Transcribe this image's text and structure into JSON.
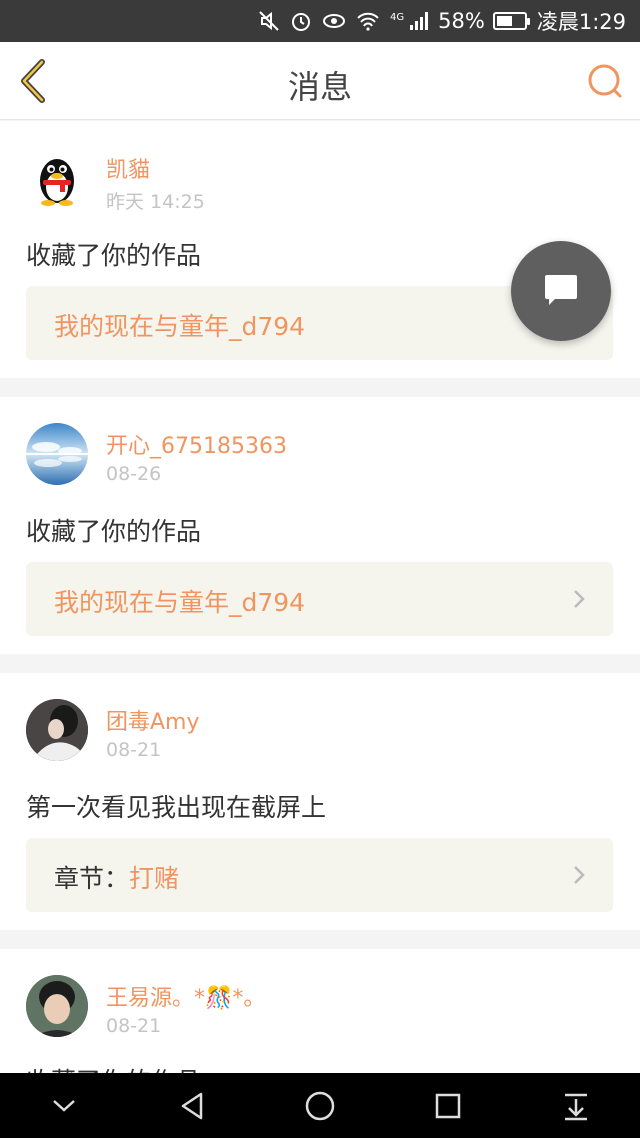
{
  "status_bar": {
    "battery_percent": "58%",
    "time": "凌晨1:29",
    "network": "4G",
    "battery_level": 0.58,
    "icons": [
      "mute-icon",
      "alarm-icon",
      "eye-icon",
      "wifi-icon",
      "signal-icon",
      "battery-icon"
    ]
  },
  "header": {
    "title": "消息",
    "back_icon": "chevron-left-icon",
    "search_icon": "search-icon"
  },
  "messages": [
    {
      "user": "凯貓",
      "time": "昨天 14:25",
      "action": "收藏了你的作品",
      "target_prefix": "",
      "target": "我的现在与童年_d794",
      "avatar": "qq-penguin"
    },
    {
      "user": "开心_675185363",
      "time": "08-26",
      "action": "收藏了你的作品",
      "target_prefix": "",
      "target": "我的现在与童年_d794",
      "avatar": "sky-water"
    },
    {
      "user": "团毒Amy",
      "time": "08-21",
      "action": "第一次看见我出现在截屏上",
      "target_prefix": "章节：",
      "target": "打赌",
      "avatar": "girl-portrait"
    },
    {
      "user": "王易源。*🎊*。",
      "time": "08-21",
      "action": "收藏了你的作品",
      "target_prefix": "",
      "target": "",
      "avatar": "boy-portrait"
    }
  ],
  "fab": {
    "icon": "chat-bubble-icon"
  },
  "colors": {
    "accent": "#f0955f",
    "fab": "#5f5f5f",
    "status_bar": "#3a3a3a"
  },
  "nav_bar": {
    "icons": [
      "collapse-icon",
      "back-triangle-icon",
      "home-circle-icon",
      "recents-square-icon",
      "notification-pull-icon"
    ]
  }
}
